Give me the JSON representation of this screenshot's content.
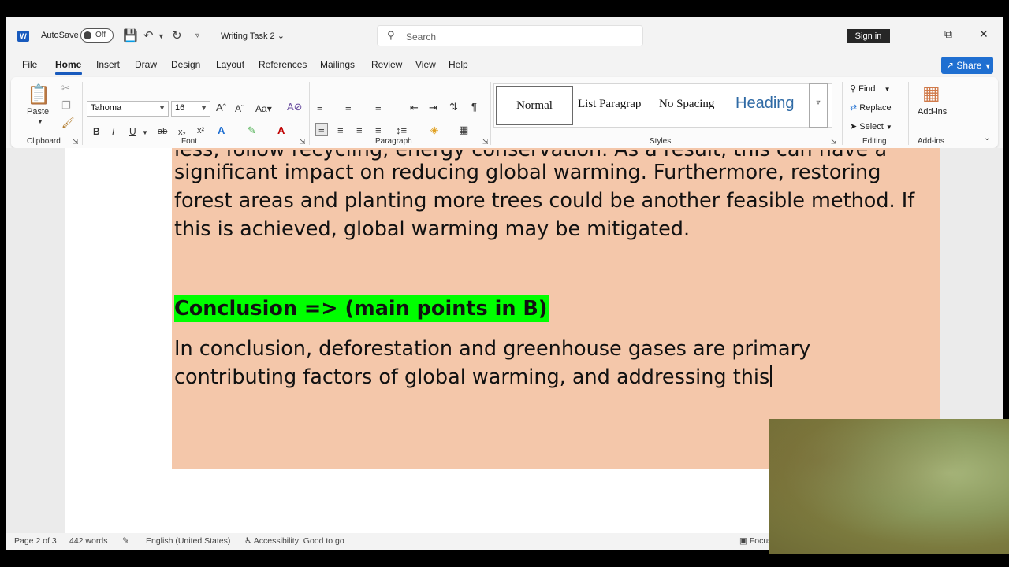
{
  "titlebar": {
    "autosave_label": "AutoSave",
    "autosave_state": "Off",
    "document_title": "Writing Task 2",
    "search_placeholder": "Search",
    "signin_label": "Sign in"
  },
  "tabs": [
    "File",
    "Home",
    "Insert",
    "Draw",
    "Design",
    "Layout",
    "References",
    "Mailings",
    "Review",
    "View",
    "Help"
  ],
  "active_tab": "Home",
  "share_label": "Share",
  "ribbon": {
    "clipboard": {
      "paste_label": "Paste",
      "group_label": "Clipboard"
    },
    "font": {
      "name": "Tahoma",
      "size": "16",
      "group_label": "Font",
      "change_case": "Aa"
    },
    "paragraph": {
      "group_label": "Paragraph"
    },
    "styles": {
      "items": [
        "Normal",
        "List Paragrap",
        "No Spacing",
        "Heading"
      ],
      "group_label": "Styles"
    },
    "editing": {
      "find": "Find",
      "replace": "Replace",
      "select": "Select",
      "group_label": "Editing"
    },
    "addins": {
      "label": "Add-ins",
      "group_label": "Add-ins"
    }
  },
  "document": {
    "line_partial": "less, follow recycling, energy conservation. As a result, this can have a",
    "line1": "significant impact on reducing global warming.  Furthermore, restoring",
    "line2": "forest areas and planting more trees could be another feasible method. If",
    "line3": "this is achieved, global warming may be mitigated.",
    "heading": "Conclusion => (main points in B)",
    "line4": "In conclusion, deforestation and greenhouse gases are primary",
    "line5": "contributing factors of global warming, and addressing this"
  },
  "statusbar": {
    "page": "Page 2 of 3",
    "words": "442 words",
    "language": "English (United States)",
    "accessibility": "Accessibility: Good to go",
    "focus": "Focus"
  },
  "colors": {
    "accent": "#185abd",
    "shading": "#f4c7aa",
    "highlight": "#00ff00",
    "heading_style": "#2f6aa5"
  }
}
